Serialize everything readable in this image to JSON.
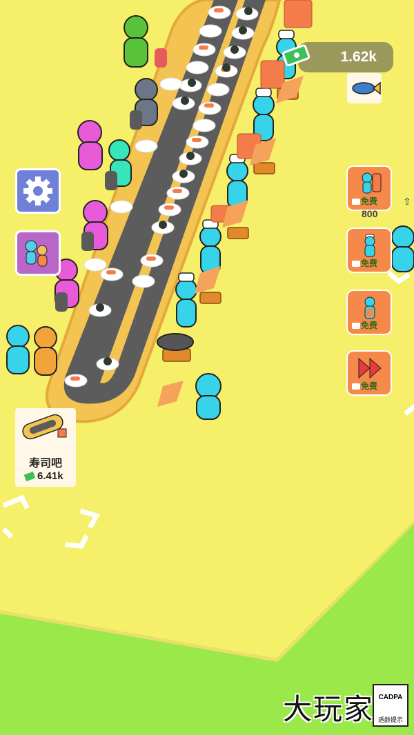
{
  "hud": {
    "money": "1.62k"
  },
  "upgrades": [
    {
      "label": "免费",
      "icon": "chef-stack-icon"
    },
    {
      "label": "免费",
      "icon": "chef-knife-icon"
    },
    {
      "label": "免费",
      "icon": "staff-icon"
    },
    {
      "label": "免费",
      "icon": "fast-forward-icon"
    }
  ],
  "upgrade_price": "800",
  "shop": {
    "name": "寿司吧",
    "price": "6.41k"
  },
  "watermark": "大玩家",
  "age_badge": {
    "top": "CADPA",
    "tip": "适龄提示"
  },
  "colors": {
    "ground": "#f6ef6a",
    "grass": "#9be84a",
    "counter": "#f3c451",
    "conveyor": "#5a5a5a",
    "upgrade_bg": "#f5894a"
  }
}
